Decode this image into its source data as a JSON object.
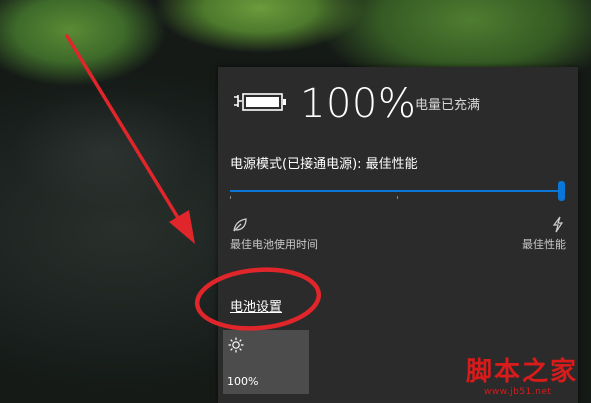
{
  "battery": {
    "percent": "100%",
    "status": "电量已充满",
    "icon": "battery-full-charging-icon"
  },
  "power_mode": {
    "label": "电源模式(已接通电源): 最佳性能",
    "level": 1.0,
    "left_caption": "最佳电池使用时间",
    "right_caption": "最佳性能",
    "left_icon": "leaf-icon",
    "right_icon": "lightning-bolt-icon",
    "accent_color": "#0a77d8"
  },
  "settings_link": "电池设置",
  "brightness_tile": {
    "icon": "sun-icon",
    "label": "100%"
  },
  "watermark": {
    "main": "脚本之家",
    "sub": "www.jb51.net"
  },
  "annotation_color": "#e0262b"
}
